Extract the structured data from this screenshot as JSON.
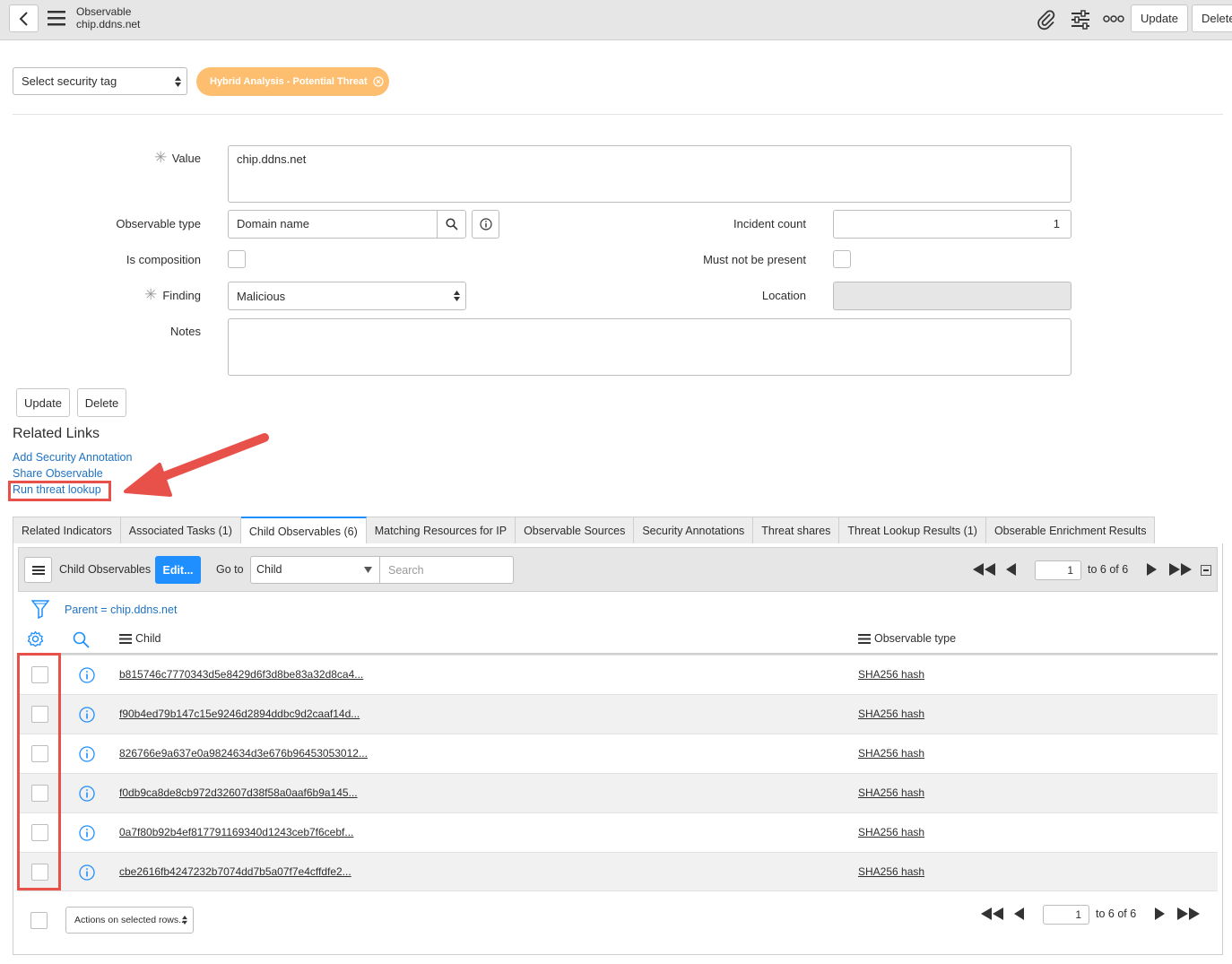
{
  "header": {
    "title": "Observable",
    "subtitle": "chip.ddns.net",
    "update_label": "Update",
    "delete_label": "Delete"
  },
  "tags": {
    "select_placeholder": "Select security tag",
    "pill_label": "Hybrid Analysis - Potential Threat",
    "pill_color": "#fdbf6f"
  },
  "form": {
    "value_label": "Value",
    "value": "chip.ddns.net",
    "observable_type_label": "Observable type",
    "observable_type": "Domain name",
    "is_composition_label": "Is composition",
    "finding_label": "Finding",
    "finding": "Malicious",
    "notes_label": "Notes",
    "notes": "",
    "incident_count_label": "Incident count",
    "incident_count": "1",
    "must_not_be_present_label": "Must not be present",
    "location_label": "Location",
    "location": ""
  },
  "actions": {
    "update_label": "Update",
    "delete_label": "Delete"
  },
  "related_links": {
    "title": "Related Links",
    "items": [
      "Add Security Annotation",
      "Share Observable",
      "Run threat lookup"
    ]
  },
  "tabs": [
    "Related Indicators",
    "Associated Tasks (1)",
    "Child Observables (6)",
    "Matching Resources for IP",
    "Observable Sources",
    "Security Annotations",
    "Threat shares",
    "Threat Lookup Results (1)",
    "Obserable Enrichment Results"
  ],
  "list": {
    "title": "Child Observables",
    "edit_label": "Edit...",
    "goto_label": "Go to",
    "goto_field": "Child",
    "search_placeholder": "Search",
    "page": "1",
    "page_of": "to 6 of 6",
    "filter": "Parent = chip.ddns.net",
    "columns": {
      "child": "Child",
      "observable_type": "Observable type"
    },
    "rows": [
      {
        "child": "b815746c7770343d5e8429d6f3d8be83a32d8ca4...",
        "type": "SHA256 hash"
      },
      {
        "child": "f90b4ed79b147c15e9246d2894ddbc9d2caaf14d...",
        "type": "SHA256 hash"
      },
      {
        "child": "826766e9a637e0a9824634d3e676b96453053012...",
        "type": "SHA256 hash"
      },
      {
        "child": "f0db9ca8de8cb972d32607d38f58a0aaf6b9a145...",
        "type": "SHA256 hash"
      },
      {
        "child": "0a7f80b92b4ef817791169340d1243ceb7f6cebf...",
        "type": "SHA256 hash"
      },
      {
        "child": "cbe2616fb4247232b7074dd7b5a07f7e4cffdfe2...",
        "type": "SHA256 hash"
      }
    ],
    "actions_select": "Actions on selected rows...",
    "bottom_page": "1",
    "bottom_page_of": "to 6 of 6"
  },
  "colors": {
    "accent": "#1f8fff",
    "link": "#1f73c4",
    "highlight": "#e8504a"
  }
}
